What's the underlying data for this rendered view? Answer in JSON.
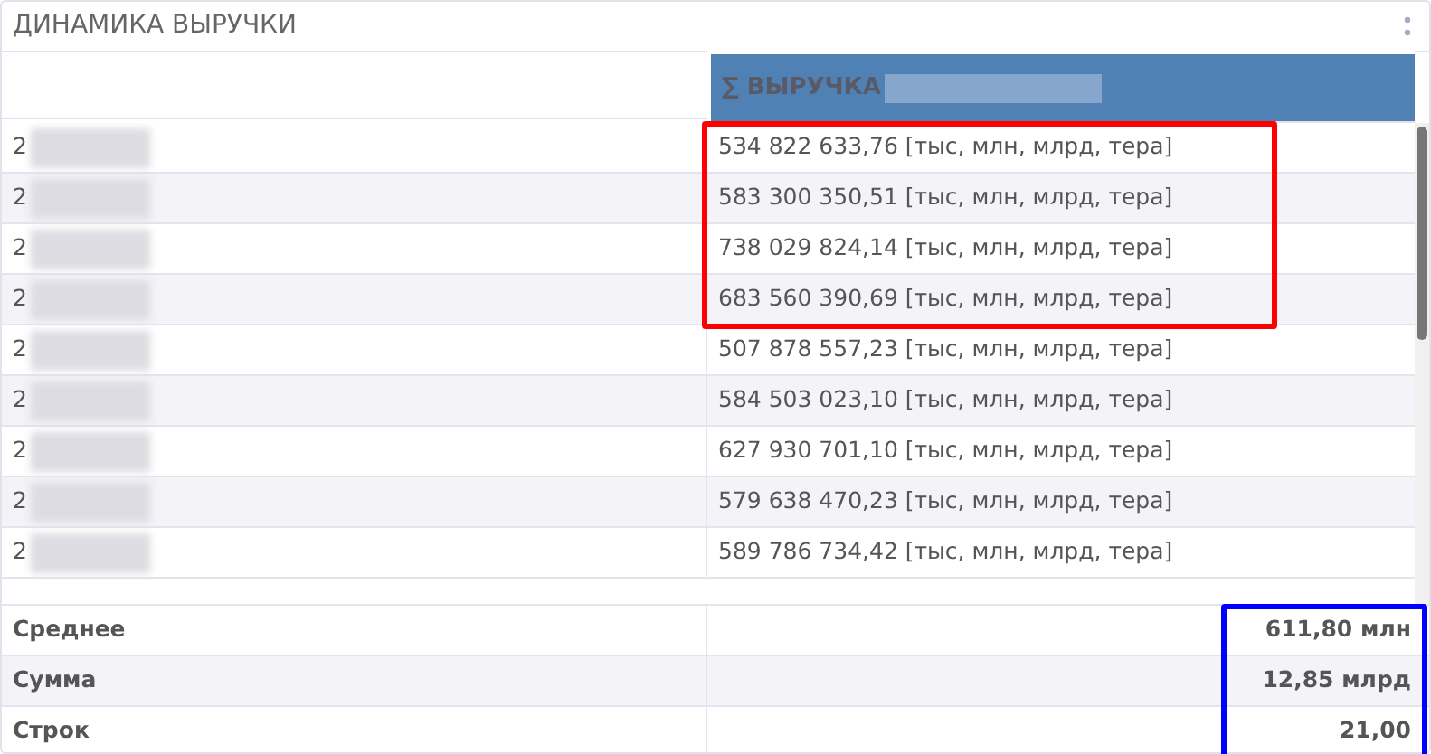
{
  "panel": {
    "title": "ДИНАМИКА ВЫРУЧКИ"
  },
  "table": {
    "value_column": {
      "label": "∑ ВЫРУЧКА "
    },
    "row_groups": [
      {
        "frame": {
          "color": "#ff0000"
        },
        "rows": [
          {
            "label": "2",
            "value": "534 822 633,76 [тыс, млн, млрд, тера]"
          },
          {
            "label": "2",
            "value": "583 300 350,51 [тыс, млн, млрд, тера]"
          },
          {
            "label": "2",
            "value": "738 029 824,14 [тыс, млн, млрд, тера]"
          },
          {
            "label": "2",
            "value": "683 560 390,69 [тыс, млн, млрд, тера]"
          }
        ]
      },
      {
        "rows": [
          {
            "label": "2",
            "value": "507 878 557,23 [тыс, млн, млрд, тера]"
          },
          {
            "label": "2",
            "value": "584 503 023,10 [тыс, млн, млрд, тера]"
          },
          {
            "label": "2",
            "value": "627 930 701,10 [тыс, млн, млрд, тера]"
          },
          {
            "label": "2",
            "value": "579 638 470,23 [тыс, млн, млрд, тера]"
          },
          {
            "label": "2",
            "value": "589 786 734,42 [тыс, млн, млрд, тера]"
          }
        ]
      }
    ],
    "summary": {
      "frame": {
        "color": "#0000ff"
      },
      "rows": [
        {
          "label": "Среднее",
          "value": "611,80 млн"
        },
        {
          "label": "Сумма",
          "value": "12,85 млрд"
        },
        {
          "label": "Строк",
          "value": "21,00"
        }
      ]
    }
  }
}
